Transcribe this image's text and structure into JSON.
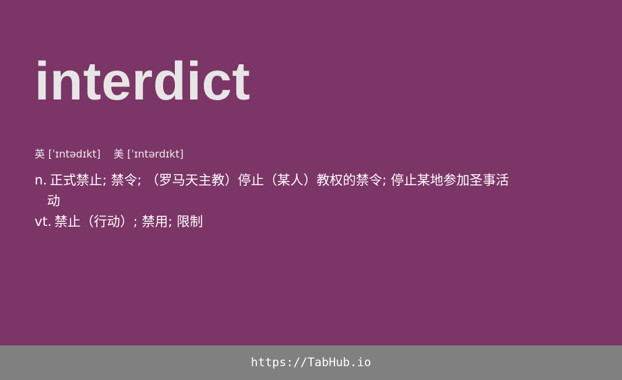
{
  "word": "interdict",
  "phonetics": {
    "uk": "英 [ˈɪntədɪkt]",
    "us": "美 [ˈɪntərdɪkt]"
  },
  "definitions": [
    {
      "pos": "n.",
      "text": "正式禁止; 禁令; （罗马天主教）停止（某人）教权的禁令; 停止某地参加圣事活动"
    },
    {
      "pos": "vt.",
      "text": "禁止（行动）; 禁用; 限制"
    }
  ],
  "footer": {
    "link": "https://TabHub.io"
  },
  "colors": {
    "background": "#7b3566",
    "footer_background": "#808080",
    "word_text": "#e6e6e6",
    "body_text": "#ffffff"
  }
}
